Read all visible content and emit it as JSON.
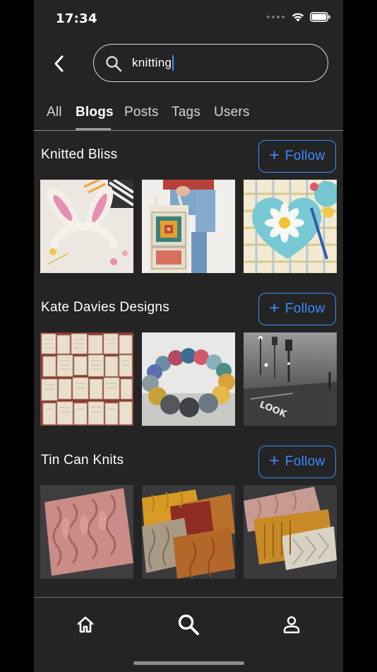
{
  "status_bar": {
    "time": "17:34"
  },
  "search": {
    "query": "knitting"
  },
  "tabs": [
    {
      "label": "All"
    },
    {
      "label": "Blogs",
      "active": true
    },
    {
      "label": "Posts"
    },
    {
      "label": "Tags"
    },
    {
      "label": "Users"
    }
  ],
  "blogs": [
    {
      "title": "Knitted Bliss",
      "follow_label": "Follow",
      "thumbnails": [
        "crochet-bunny-ears-headband",
        "granny-square-tote-bag",
        "crochet-daisy-heart"
      ]
    },
    {
      "title": "Kate Davies Designs",
      "follow_label": "Follow",
      "thumbnails": [
        "old-book-pages-wall",
        "yarn-ball-ring",
        "foggy-street-look"
      ]
    },
    {
      "title": "Tin Can Knits",
      "follow_label": "Follow",
      "thumbnails": [
        "pink-cable-swatch",
        "stacked-cable-swatches",
        "fanned-cable-swatches"
      ]
    }
  ],
  "bottom_nav": [
    "home-icon",
    "search-icon",
    "profile-icon"
  ],
  "colors": {
    "accent": "#3d8bff",
    "background": "#242424",
    "text": "#ffffff"
  }
}
